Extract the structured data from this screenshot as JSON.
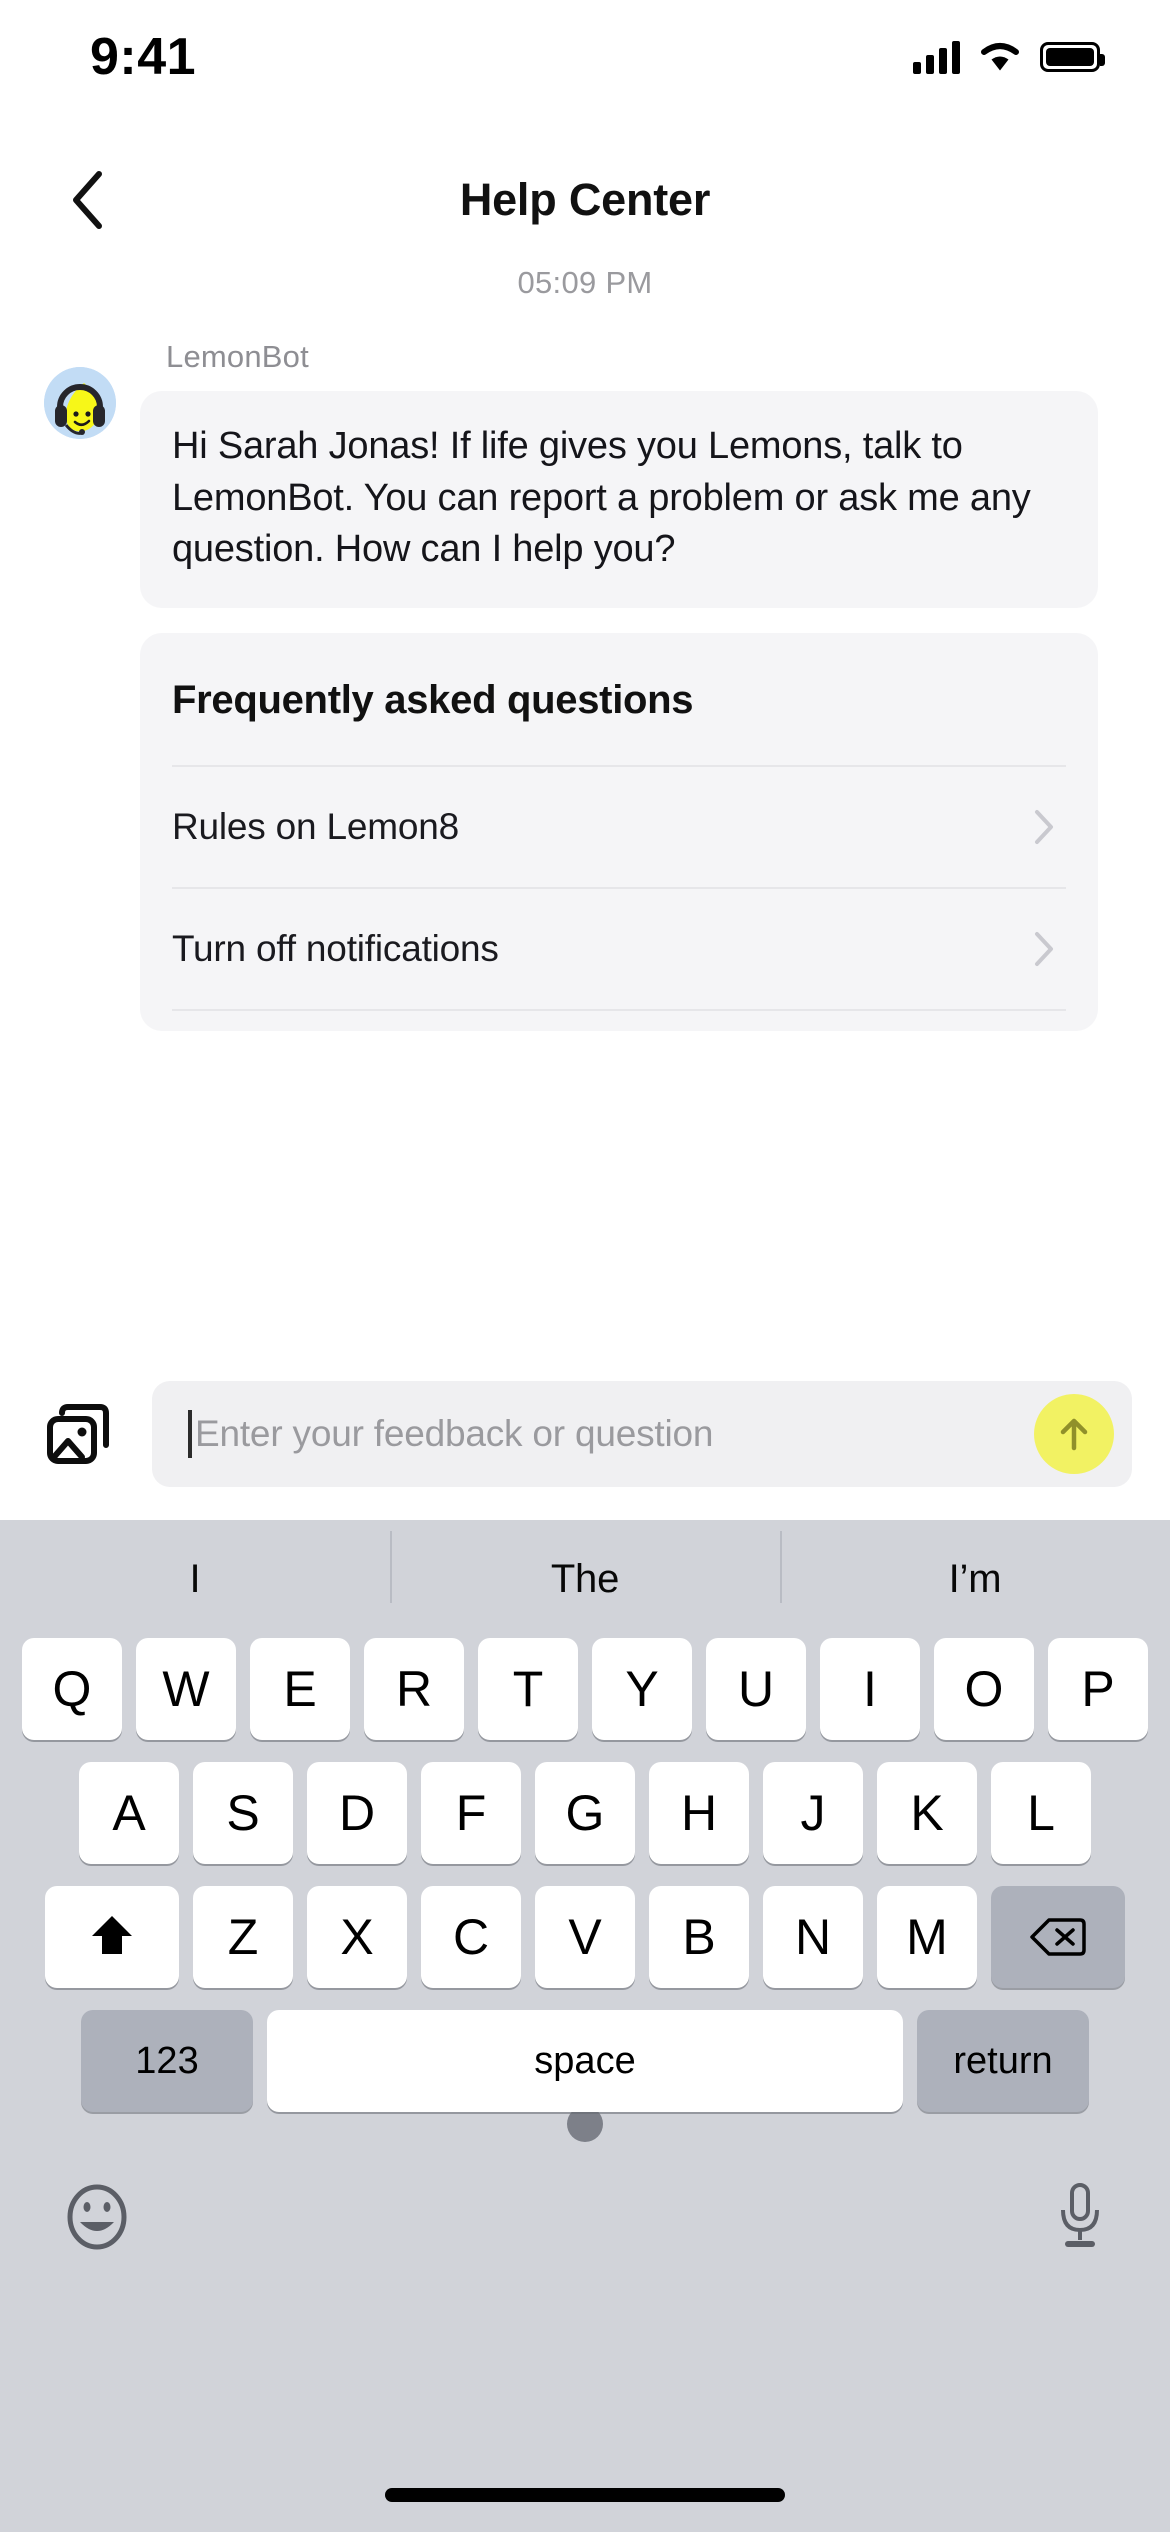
{
  "status_bar": {
    "time": "9:41",
    "signal_icon": "cellular-signal-icon",
    "wifi_icon": "wifi-icon",
    "battery_icon": "battery-full-icon"
  },
  "nav": {
    "back_icon": "chevron-left-icon",
    "title": "Help Center"
  },
  "chat": {
    "timestamp": "05:09 PM",
    "bot_name": "LemonBot",
    "avatar_icon": "lemonbot-avatar-icon",
    "message": "Hi Sarah Jonas! If life gives you Lemons, talk to LemonBot. You can report a problem or ask me any question. How can I help you?",
    "faq": {
      "title": "Frequently asked questions",
      "items": [
        {
          "label": "Rules on Lemon8",
          "chevron_icon": "chevron-right-icon"
        },
        {
          "label": "Turn off notifications",
          "chevron_icon": "chevron-right-icon"
        }
      ]
    }
  },
  "input_bar": {
    "photo_icon": "photo-library-icon",
    "placeholder": "Enter your feedback or question",
    "value": "",
    "send_icon": "arrow-up-icon",
    "send_color": "#f2f263"
  },
  "keyboard": {
    "suggestions": [
      "I",
      "The",
      "I’m"
    ],
    "row1": [
      "Q",
      "W",
      "E",
      "R",
      "T",
      "Y",
      "U",
      "I",
      "O",
      "P"
    ],
    "row2": [
      "A",
      "S",
      "D",
      "F",
      "G",
      "H",
      "J",
      "K",
      "L"
    ],
    "row3": [
      "Z",
      "X",
      "C",
      "V",
      "B",
      "N",
      "M"
    ],
    "shift_icon": "shift-up-icon",
    "delete_icon": "backspace-delete-icon",
    "numbers_label": "123",
    "space_label": "space",
    "return_label": "return",
    "emoji_icon": "emoji-smiley-icon",
    "mic_icon": "microphone-icon"
  }
}
